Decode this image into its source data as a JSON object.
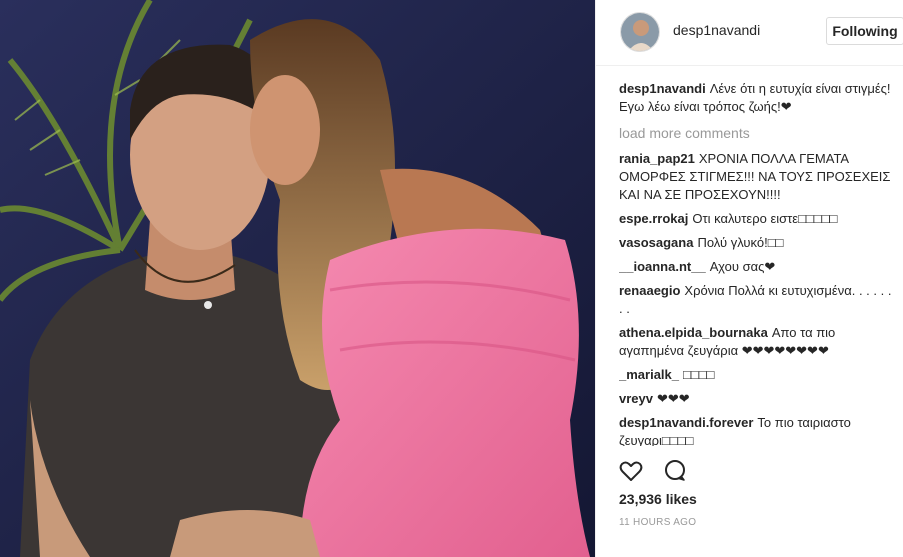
{
  "post": {
    "username": "desp1navandi",
    "follow_label": "Following",
    "likes": "23,936 likes",
    "time": "11 HOURS AGO"
  },
  "comments": {
    "caption": {
      "user": "desp1navandi",
      "text": "Λένε ότι η ευτυχία είναι στιγμές!Εγω λέω είναι τρόπος ζωής!❤"
    },
    "load_more": "load more comments",
    "items": [
      {
        "user": "rania_pap21",
        "text": "ΧΡΟΝΙΑ ΠΟΛΛΑ ΓΕΜΑΤΑ ΟΜΟΡΦΕΣ ΣΤΙΓΜΕΣ!!! ΝΑ ΤΟΥΣ ΠΡΟΣΕΧΕΙΣ ΚΑΙ ΝΑ ΣΕ ΠΡΟΣΕΧΟΥΝ!!!!"
      },
      {
        "user": "espe.rrokaj",
        "text": "Οτι καλυτερο ειστε□□□□□"
      },
      {
        "user": "vasosagana",
        "text": "Πολύ γλυκό!□□"
      },
      {
        "user": "__ioanna.nt__",
        "text": "Αχου σας❤"
      },
      {
        "user": "renaaegio",
        "text": "Χρόνια Πολλά κι ευτυχισμένα. . . . . . . ."
      },
      {
        "user": "athena.elpida_bournaka",
        "text": "Απο τα πιο αγαπημένα ζευγάρια ❤❤❤❤❤❤❤❤"
      },
      {
        "user": "_marialk_",
        "text": "□□□□"
      },
      {
        "user": "vreyv",
        "text": "❤❤❤"
      },
      {
        "user": "desp1navandi.forever",
        "text": "Το πιο ταιριαστο ζευγαρι□□□□"
      }
    ]
  },
  "icons": {
    "like": "heart-icon",
    "comment": "comment-bubble-icon"
  },
  "colors": {
    "text": "#262626",
    "muted": "#999999",
    "border": "#dbdbdb",
    "dress": "#f27aa5",
    "background_photo": "#1f2448"
  }
}
